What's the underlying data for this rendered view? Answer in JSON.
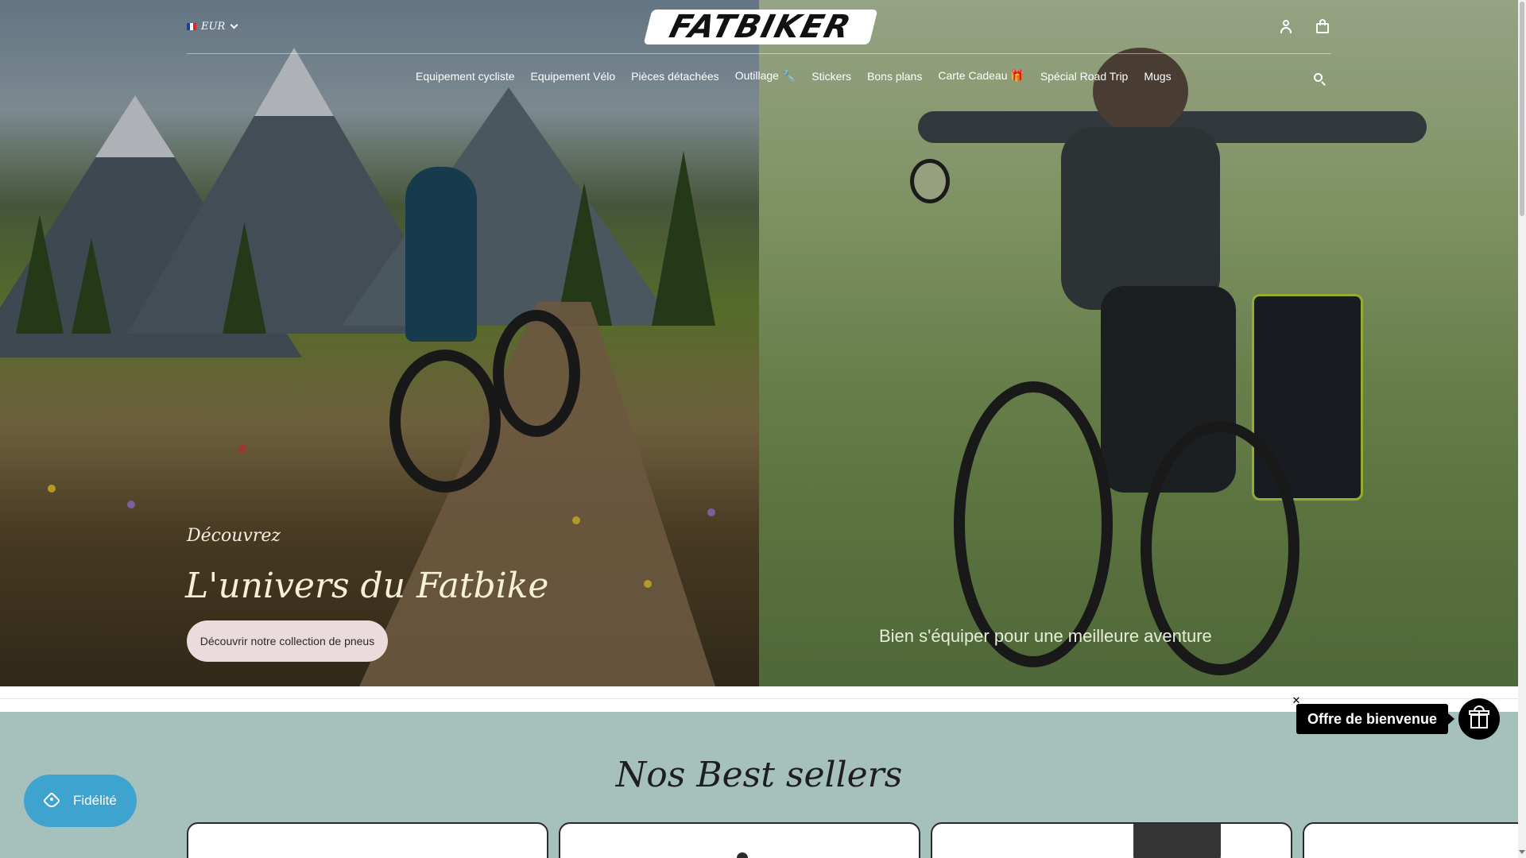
{
  "header": {
    "currency": "EUR",
    "logo_text": "FATBIKER",
    "nav": [
      "Equipement cycliste",
      "Equipement Vélo",
      "Pièces détachées",
      "Outillage 🔧",
      "Stickers",
      "Bons plans",
      "Carte Cadeau 🎁",
      "Spécial Road Trip",
      "Mugs"
    ]
  },
  "hero": {
    "left": {
      "eyebrow": "Découvrez",
      "title": "L'univers du Fatbike",
      "cta": "Découvrir notre collection de pneus"
    },
    "right": {
      "text": "Bien s'équiper pour une meilleure aventure"
    }
  },
  "best_sellers": {
    "title": "Nos Best sellers"
  },
  "widgets": {
    "loyalty_label": "Fidélité",
    "offer_label": "Offre de bienvenue",
    "close_label": "✕"
  },
  "colors": {
    "section_bg": "#a6c1bc",
    "loyalty_bg": "#3fa3cf",
    "button_bg": "#eadbdd",
    "flag": [
      "#1d3f9a",
      "#ffffff",
      "#e1262a"
    ]
  }
}
